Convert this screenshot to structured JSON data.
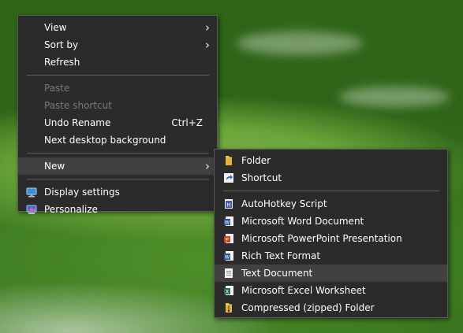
{
  "context_menu": {
    "items": [
      {
        "label": "View"
      },
      {
        "label": "Sort by"
      },
      {
        "label": "Refresh"
      },
      {
        "label": "Paste"
      },
      {
        "label": "Paste shortcut"
      },
      {
        "label": "Undo Rename",
        "shortcut": "Ctrl+Z"
      },
      {
        "label": "Next desktop background"
      },
      {
        "label": "New"
      },
      {
        "label": "Display settings",
        "icon": "display-icon"
      },
      {
        "label": "Personalize",
        "icon": "personalize-icon"
      }
    ]
  },
  "new_submenu": {
    "items": [
      {
        "label": "Folder",
        "icon": "folder-icon"
      },
      {
        "label": "Shortcut",
        "icon": "shortcut-icon"
      },
      {
        "label": "AutoHotkey Script",
        "icon": "autohotkey-icon"
      },
      {
        "label": "Microsoft Word Document",
        "icon": "word-icon"
      },
      {
        "label": "Microsoft PowerPoint Presentation",
        "icon": "powerpoint-icon"
      },
      {
        "label": "Rich Text Format",
        "icon": "rtf-icon"
      },
      {
        "label": "Text Document",
        "icon": "text-document-icon"
      },
      {
        "label": "Microsoft Excel Worksheet",
        "icon": "excel-icon"
      },
      {
        "label": "Compressed (zipped) Folder",
        "icon": "zip-folder-icon"
      }
    ],
    "highlighted_item": "Text Document"
  },
  "colors": {
    "menu_background": "#2b2b2b",
    "menu_border": "#5a5a5a",
    "highlight": "#414141",
    "disabled_text": "#7a7a7a"
  }
}
